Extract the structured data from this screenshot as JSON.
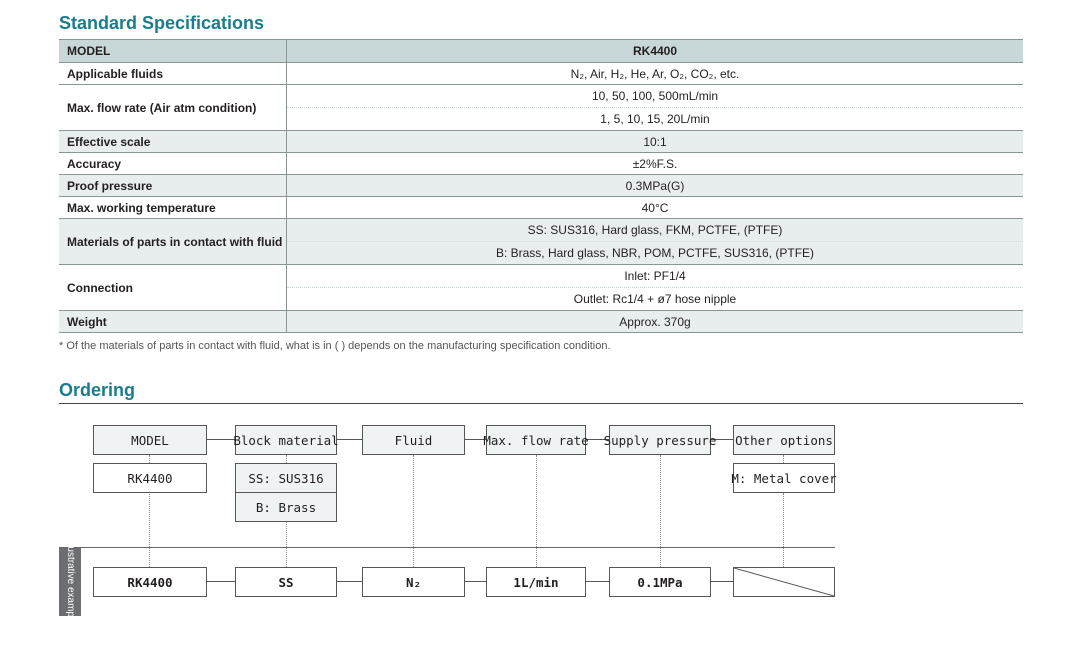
{
  "spec": {
    "title": "Standard Specifications",
    "model_label": "MODEL",
    "model_value": "RK4400",
    "rows": [
      {
        "label": "Applicable fluids",
        "values": [
          "N₂, Air, H₂, He, Ar, O₂, CO₂, etc."
        ]
      },
      {
        "label": "Max. flow rate (Air atm condition)",
        "values": [
          "10, 50, 100, 500mL/min",
          "1, 5, 10, 15, 20L/min"
        ]
      },
      {
        "label": "Effective scale",
        "values": [
          "10:1"
        ]
      },
      {
        "label": "Accuracy",
        "values": [
          "±2%F.S."
        ]
      },
      {
        "label": "Proof pressure",
        "values": [
          "0.3MPa(G)"
        ]
      },
      {
        "label": "Max. working temperature",
        "values": [
          "40°C"
        ]
      },
      {
        "label": "Materials of parts in contact with fluid",
        "values": [
          "SS: SUS316, Hard glass, FKM, PCTFE, (PTFE)",
          "B: Brass, Hard glass, NBR, POM, PCTFE, SUS316, (PTFE)"
        ]
      },
      {
        "label": "Connection",
        "values": [
          "Inlet: PF1/4",
          "Outlet: Rc1/4 + ø7 hose nipple"
        ]
      },
      {
        "label": "Weight",
        "values": [
          "Approx. 370g"
        ]
      }
    ],
    "note": "* Of the materials of parts in contact with fluid, what is in ( ) depends on the manufacturing specification condition."
  },
  "ordering": {
    "title": "Ordering",
    "headers": [
      "MODEL",
      "Block material",
      "Fluid",
      "Max. flow rate",
      "Supply pressure",
      "Other options"
    ],
    "options": {
      "model": [
        "RK4400"
      ],
      "block": [
        "SS: SUS316",
        "B: Brass"
      ],
      "other": [
        "M: Metal cover"
      ]
    },
    "example_label": "Illustrative example",
    "example": [
      "RK4400",
      "SS",
      "N₂",
      "1L/min",
      "0.1MPa",
      ""
    ]
  },
  "colors": {
    "accent": "#1a7d8e",
    "header_bg": "#c8d8d9",
    "shade_bg": "#e8eeee"
  }
}
